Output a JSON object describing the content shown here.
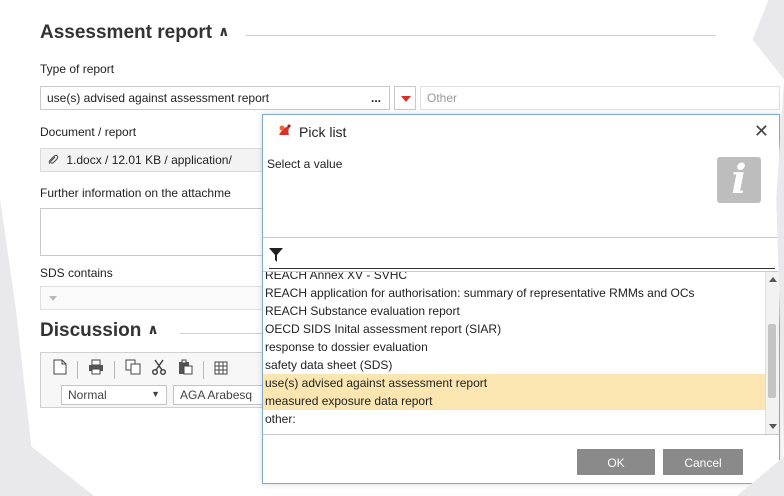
{
  "assessment": {
    "title": "Assessment report",
    "type_label": "Type of report",
    "type_value": "use(s) advised against assessment report",
    "type_more": "...",
    "other_placeholder": "Other",
    "doc_label": "Document / report",
    "doc_value": "1.docx / 12.01 KB / application/",
    "further_label": "Further information on the attachme",
    "sds_label": "SDS contains"
  },
  "discussion": {
    "title": "Discussion",
    "style_select": "Normal",
    "font_select": "AGA Arabesq"
  },
  "dialog": {
    "title": "Pick list",
    "subtitle": "Select a value",
    "items": [
      "REACH Annex XV - SVHC",
      "REACH application for authorisation: summary of representative RMMs and OCs",
      "REACH Substance evaluation report",
      "OECD SIDS Inital assessment report (SIAR)",
      "response to dossier evaluation",
      "safety data sheet (SDS)",
      "use(s) advised against assessment report",
      "measured exposure data report",
      "other:"
    ],
    "selected": [
      6,
      7
    ],
    "ok_label": "OK",
    "cancel_label": "Cancel"
  },
  "colors": {
    "accent_red": "#d9302a",
    "selection": "#fbe6b1",
    "button": "#8a8a8a"
  }
}
